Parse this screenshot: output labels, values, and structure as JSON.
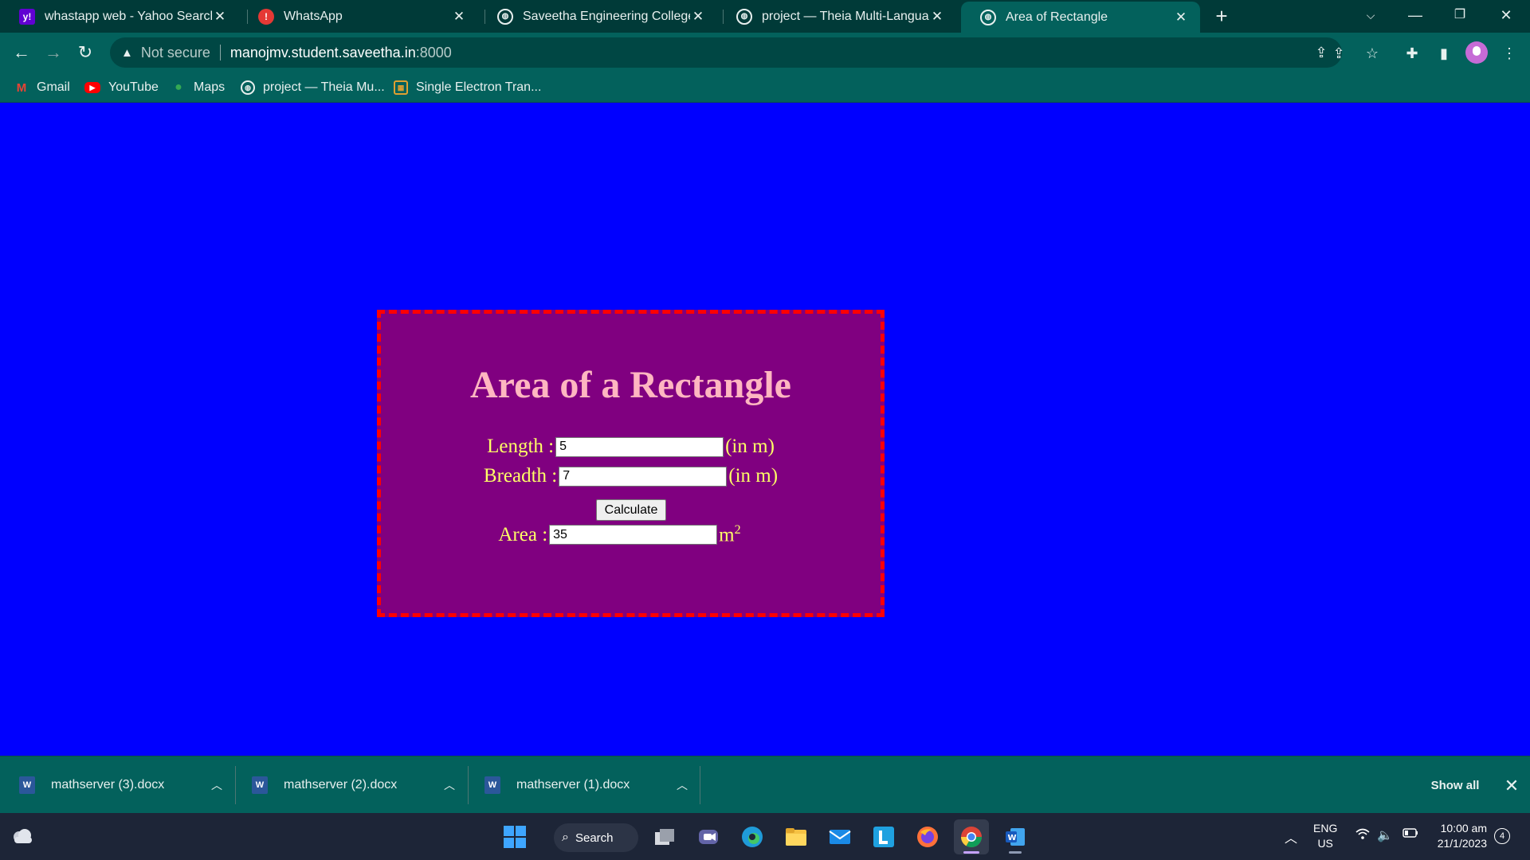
{
  "tabs": [
    {
      "title": "whastapp web - Yahoo Search Re",
      "icon": "yahoo-icon",
      "active": false
    },
    {
      "title": "WhatsApp",
      "icon": "alert-icon",
      "active": false
    },
    {
      "title": "Saveetha Engineering College",
      "icon": "globe-icon",
      "active": false
    },
    {
      "title": "project — Theia Multi-Language",
      "icon": "globe-icon",
      "active": false
    },
    {
      "title": "Area of Rectangle",
      "icon": "globe-icon",
      "active": true
    }
  ],
  "address_bar": {
    "security_label": "Not secure",
    "host": "manojmv.student.saveetha.in",
    "port": ":8000"
  },
  "bookmarks": [
    {
      "label": "Gmail",
      "icon": "gmail-icon"
    },
    {
      "label": "YouTube",
      "icon": "youtube-icon"
    },
    {
      "label": "Maps",
      "icon": "maps-icon"
    },
    {
      "label": "project — Theia Mu...",
      "icon": "globe-icon"
    },
    {
      "label": "Single Electron Tran...",
      "icon": "chip-icon"
    }
  ],
  "page": {
    "heading": "Area of a Rectangle",
    "length": {
      "label": "Length :",
      "value": "5",
      "unit": "(in m)"
    },
    "breadth": {
      "label": "Breadth :",
      "value": "7",
      "unit": "(in m)"
    },
    "calculate_label": "Calculate",
    "area": {
      "label": "Area :",
      "value": "35",
      "unit": "m",
      "unit_sup": "2"
    },
    "colors": {
      "background": "#0000ff",
      "box": "#800080",
      "border": "#ff0000",
      "heading": "#ffb6c1",
      "labels": "#ffff66"
    }
  },
  "downloads": {
    "items": [
      {
        "name": "mathserver (3).docx"
      },
      {
        "name": "mathserver (2).docx"
      },
      {
        "name": "mathserver (1).docx"
      }
    ],
    "show_all": "Show all"
  },
  "taskbar": {
    "search_label": "Search",
    "lang_line1": "ENG",
    "lang_line2": "US",
    "time": "10:00 am",
    "date": "21/1/2023",
    "notifications": "4"
  }
}
